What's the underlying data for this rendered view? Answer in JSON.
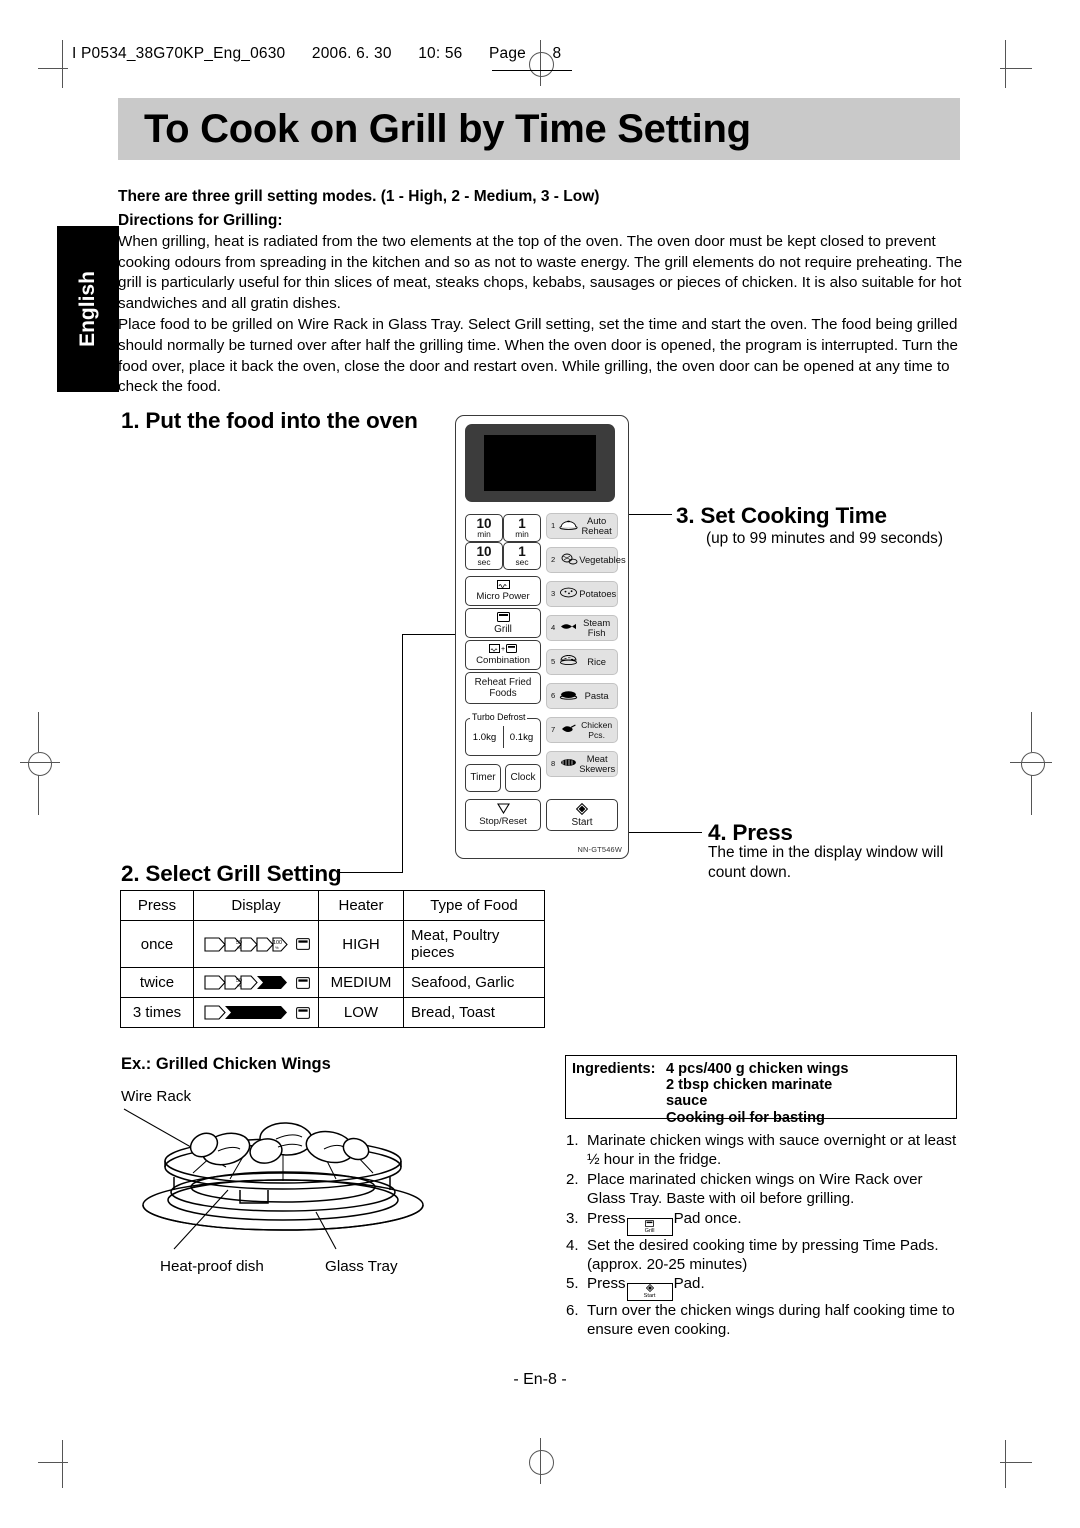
{
  "imprint": {
    "file": "I P0534_38G70KP_Eng_0630",
    "date": "2006. 6. 30",
    "time": "10: 56",
    "page_label": "Page",
    "page_number": "8"
  },
  "title": "To Cook on Grill by Time Setting",
  "language_tab": "English",
  "intro": {
    "modes_line": "There are three grill setting modes. (1 - High, 2 - Medium, 3 - Low)",
    "directions_heading": "Directions for Grilling:",
    "paragraph_1": "When grilling, heat is radiated from the two elements at the top of the oven. The oven door must be kept closed to prevent cooking odours from spreading in the kitchen and so as not to waste energy. The grill elements do not require preheating. The grill is particularly useful for thin slices of meat, steaks chops, kebabs, sausages or pieces of chicken. It is also suitable for hot sandwiches and all gratin dishes.",
    "paragraph_2": "Place food to be grilled on Wire Rack in Glass Tray. Select Grill setting, set the time and start the oven. The food being grilled should normally be turned over after half the grilling time. When the oven door is opened, the program is interrupted. Turn the food over, place it back the oven, close the door and restart oven. While grilling, the oven door can be opened at any time to check the food."
  },
  "steps": {
    "step1": "1. Put the food into the oven",
    "step2": "2. Select Grill Setting",
    "step3": "3. Set Cooking Time",
    "step3_sub": "(up to 99 minutes and 99 seconds)",
    "step4": "4. Press",
    "step4_sub": "The time in the display window will count down."
  },
  "control_panel": {
    "model": "NN-GT546W",
    "time_pads": [
      {
        "value": "10",
        "unit": "min"
      },
      {
        "value": "1",
        "unit": "min"
      },
      {
        "value": "10",
        "unit": "sec"
      },
      {
        "value": "1",
        "unit": "sec"
      }
    ],
    "function_pads": [
      {
        "label": "Micro Power",
        "icon": "microwave-icon"
      },
      {
        "label": "Grill",
        "icon": "grill-icon"
      },
      {
        "label": "Combination",
        "icon": "combination-icon"
      },
      {
        "label": "Reheat Fried Foods",
        "icon": ""
      }
    ],
    "turbo_defrost": {
      "label": "Turbo Defrost",
      "left": "1.0kg",
      "right": "0.1kg"
    },
    "timer_label": "Timer",
    "clock_label": "Clock",
    "stop_label": "Stop/Reset",
    "start_label": "Start",
    "auto_pads": [
      {
        "num": "1",
        "label": "Auto Reheat",
        "icon": "covered-dish-icon"
      },
      {
        "num": "2",
        "label": "Vegetables",
        "icon": "vegetables-icon"
      },
      {
        "num": "3",
        "label": "Potatoes",
        "icon": "potato-icon"
      },
      {
        "num": "4",
        "label": "Steam Fish",
        "icon": "fish-icon"
      },
      {
        "num": "5",
        "label": "Rice",
        "icon": "rice-bowl-icon"
      },
      {
        "num": "6",
        "label": "Pasta",
        "icon": "pasta-icon"
      },
      {
        "num": "7",
        "label": "Chicken Pcs.",
        "icon": "chicken-icon"
      },
      {
        "num": "8",
        "label": "Meat Skewers",
        "icon": "skewers-icon"
      }
    ]
  },
  "grill_table": {
    "headers": [
      "Press",
      "Display",
      "Heater",
      "Type of Food"
    ],
    "rows": [
      {
        "press": "once",
        "display_fill": "0",
        "marks": [
          "50",
          "100"
        ],
        "heater": "HIGH",
        "food": "Meat, Poultry pieces"
      },
      {
        "press": "twice",
        "display_fill": "50",
        "marks": [
          "50"
        ],
        "heater": "MEDIUM",
        "food": "Seafood, Garlic"
      },
      {
        "press": "3 times",
        "display_fill": "100",
        "marks": [],
        "heater": "LOW",
        "food": "Bread, Toast"
      }
    ]
  },
  "example": {
    "heading": "Ex.: Grilled Chicken Wings",
    "labels": {
      "wire_rack": "Wire Rack",
      "heat_proof_dish": "Heat-proof dish",
      "glass_tray": "Glass Tray"
    },
    "ingredients_label": "Ingredients:",
    "ingredients": [
      "4 pcs/400 g chicken wings",
      "2 tbsp chicken marinate",
      "sauce",
      "Cooking oil for basting"
    ],
    "instructions": [
      {
        "n": "1.",
        "text": "Marinate chicken wings with sauce overnight or at least ½ hour in the fridge."
      },
      {
        "n": "2.",
        "text": "Place marinated chicken wings on Wire Rack over Glass Tray. Baste with oil before grilling."
      },
      {
        "n": "3.",
        "pre": "Press",
        "pad": "Grill",
        "post": "Pad once."
      },
      {
        "n": "4.",
        "text": "Set the desired cooking time by pressing Time Pads. (approx. 20-25 minutes)"
      },
      {
        "n": "5.",
        "pre": "Press",
        "pad": "Start",
        "post": "Pad."
      },
      {
        "n": "6.",
        "text": "Turn over the chicken wings during half cooking time to ensure even cooking."
      }
    ]
  },
  "footer": "- En-8 -"
}
